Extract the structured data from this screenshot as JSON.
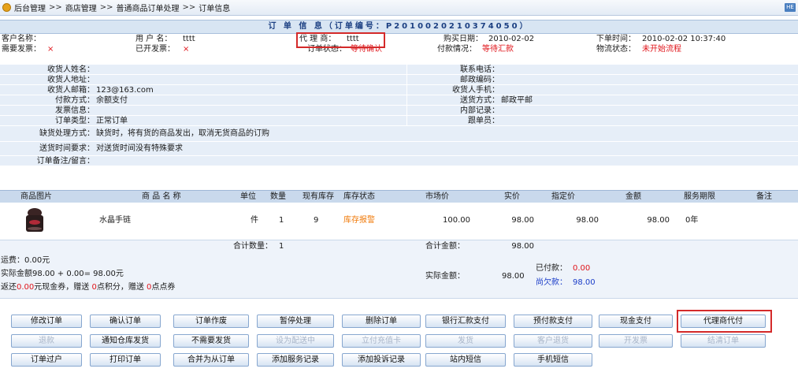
{
  "breadcrumb": {
    "items": [
      "后台管理",
      "商店管理",
      "普通商品订单处理",
      "订单信息"
    ],
    "sep": ">>",
    "help_label": "HE"
  },
  "order_title": "订 单 信 息（订单编号：P2010020210374050）",
  "info": {
    "customer_label": "客户名称：",
    "customer_value": "",
    "username_label": "用 户 名：",
    "username_value": "tttt",
    "agent_label": "代 理 商：",
    "agent_value": "tttt",
    "purchase_date_label": "购买日期：",
    "purchase_date_value": "2010-02-02",
    "order_time_label": "下单时间：",
    "order_time_value": "2010-02-02 10:37:40",
    "need_invoice_label": "需要发票：",
    "need_invoice_value": "×",
    "invoiced_label": "已开发票：",
    "invoiced_value": "×",
    "order_status_label": "订单状态：",
    "order_status_value": "等待确认",
    "payment_status_label": "付款情况：",
    "payment_status_value": "等待汇款",
    "logistics_label": "物流状态：",
    "logistics_value": "未开始流程"
  },
  "address": {
    "rows": [
      {
        "l1": "收货人姓名：",
        "v1": "",
        "l2": "联系电话：",
        "v2": ""
      },
      {
        "l1": "收货人地址：",
        "v1": "",
        "l2": "邮政编码：",
        "v2": ""
      },
      {
        "l1": "收货人邮箱：",
        "v1": "123@163.com",
        "l2": "收货人手机：",
        "v2": ""
      },
      {
        "l1": "付款方式：",
        "v1": "余额支付",
        "l2": "送货方式：",
        "v2": "邮政平邮"
      },
      {
        "l1": "发票信息：",
        "v1": "",
        "l2": "内部记录：",
        "v2": ""
      },
      {
        "l1": "订单类型：",
        "v1": "正常订单",
        "l2": "跟单员：",
        "v2": ""
      }
    ],
    "shortage_label": "缺货处理方式：",
    "shortage_value": "缺货时，将有货的商品发出，取消无货商品的订购",
    "delivery_time_label": "送货时间要求：",
    "delivery_time_value": "对送货时间没有特殊要求",
    "remark_label": "订单备注/留言：",
    "remark_value": ""
  },
  "table": {
    "headers": [
      "商品图片",
      "商 品 名 称",
      "单位",
      "数量",
      "现有库存",
      "库存状态",
      "市场价",
      "实价",
      "指定价",
      "金额",
      "服务期限",
      "备注"
    ],
    "row": {
      "name": "水晶手链",
      "unit": "件",
      "qty": "1",
      "stock": "9",
      "stock_status": "库存报警",
      "market_price": "100.00",
      "real_price": "98.00",
      "assigned_price": "98.00",
      "amount": "98.00",
      "service": "0年",
      "remark": ""
    },
    "total_qty_label": "合计数量：",
    "total_qty_value": "1",
    "total_amount_label": "合计金额：",
    "total_amount_value": "98.00"
  },
  "fees": {
    "freight": "运费：0.00元",
    "actual_amount_formula": "实际金额98.00 + 0.00= 98.00元",
    "rebate_prefix": "返还",
    "rebate_cash": "0.00",
    "rebate_mid": "元现金券，赠送",
    "rebate_points": "0",
    "rebate_mid2": "点积分，赠送",
    "rebate_coupons": "0",
    "rebate_suffix": "点点券",
    "actual_label": "实际金额：",
    "actual_value": "98.00",
    "paid_label": "已付款：",
    "paid_value": "0.00",
    "owed_label": "尚欠款：",
    "owed_value": "98.00"
  },
  "buttons": {
    "row1": [
      "修改订单",
      "确认订单",
      "订单作废",
      "暂停处理",
      "删除订单",
      "银行汇款支付",
      "预付款支付",
      "现金支付",
      "代理商代付"
    ],
    "row2": [
      "退款",
      "通知仓库发货",
      "不需要发货",
      "设为配送中",
      "立付充值卡",
      "发货",
      "客户退货",
      "开发票",
      "结清订单"
    ],
    "row3": [
      "订单过户",
      "打印订单",
      "合并为从订单",
      "添加服务记录",
      "添加投诉记录",
      "站内短信",
      "手机短信"
    ]
  },
  "colors": {
    "title_bg": "#d8e5f3",
    "title_text": "#1b3f82",
    "row_bg": "#e6eef8",
    "alert_red": "#e0141a",
    "stock_alert_orange": "#f07a0a",
    "link_blue": "#1a3cc8",
    "highlight_red": "#d42a2a"
  }
}
